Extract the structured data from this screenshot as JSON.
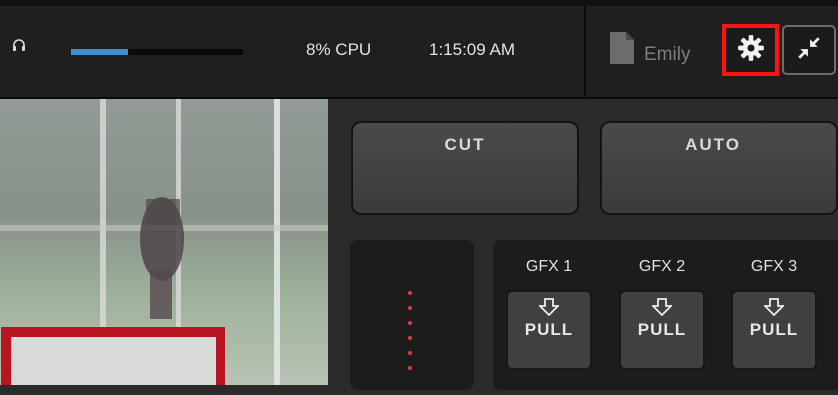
{
  "topbar": {
    "audio_level": 0.33,
    "cpu": "8% CPU",
    "clock": "1:15:09 AM",
    "user": "Emily",
    "icons": {
      "headphones": "headphones-icon",
      "document": "document-icon",
      "settings": "gear-icon",
      "minimize": "minimize-arrows-icon"
    }
  },
  "switcher": {
    "cut_label": "CUT",
    "auto_label": "AUTO"
  },
  "gfx": [
    {
      "title": "GFX 1",
      "button": "PULL"
    },
    {
      "title": "GFX 2",
      "button": "PULL"
    },
    {
      "title": "GFX 3",
      "button": "PULL"
    }
  ],
  "colors": {
    "accent_blue": "#3e90cf",
    "highlight_red": "#ff1212",
    "meter_red": "#e03a3a"
  }
}
